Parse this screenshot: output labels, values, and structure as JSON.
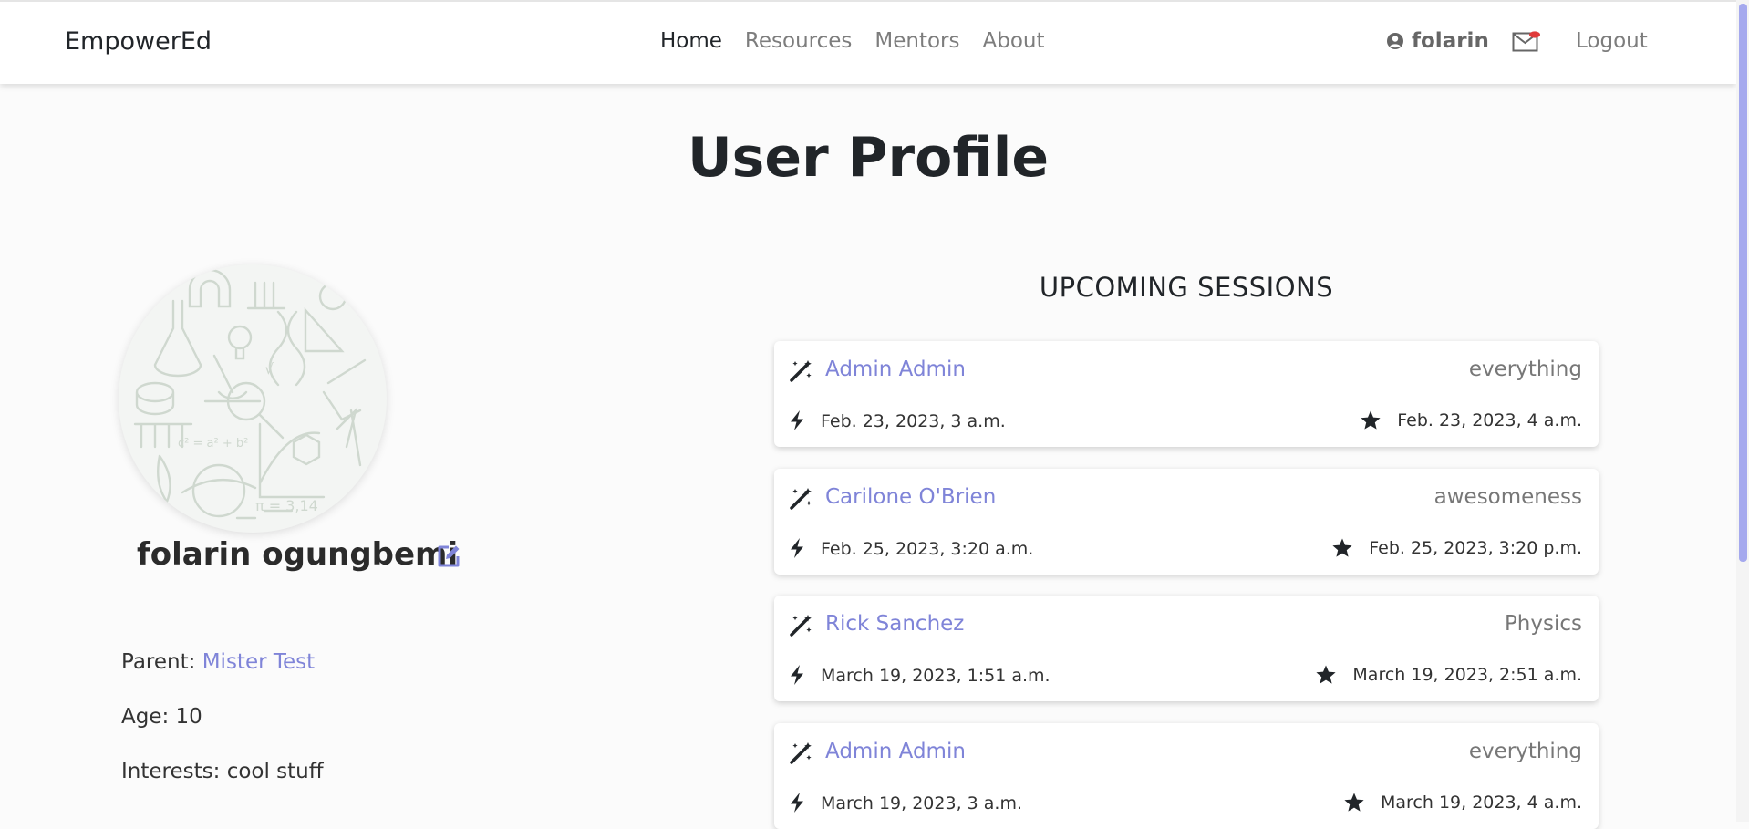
{
  "brand": "EmpowerEd",
  "nav": {
    "links": [
      "Home",
      "Resources",
      "Mentors",
      "About"
    ],
    "active": "Home",
    "username": "folarin",
    "logout": "Logout",
    "icons": {
      "user": "user-circle-icon",
      "mail": "envelope-icon"
    },
    "notification_color": "#e03a3a"
  },
  "page": {
    "title": "User Profile"
  },
  "profile": {
    "full_name": "folarin ogungbemi",
    "parent_label": "Parent:",
    "parent_name": "Mister Test",
    "age_label": "Age:",
    "age": "10",
    "interests_label": "Interests:",
    "interests": "cool stuff"
  },
  "sessions": {
    "title": "UPCOMING SESSIONS",
    "items": [
      {
        "mentor": "Admin Admin",
        "topic": "everything",
        "start": "Feb. 23, 2023, 3 a.m.",
        "end": "Feb. 23, 2023, 4 a.m."
      },
      {
        "mentor": "Carilone O'Brien",
        "topic": "awesomeness",
        "start": "Feb. 25, 2023, 3:20 a.m.",
        "end": "Feb. 25, 2023, 3:20 p.m."
      },
      {
        "mentor": "Rick Sanchez",
        "topic": "Physics",
        "start": "March 19, 2023, 1:51 a.m.",
        "end": "March 19, 2023, 2:51 a.m."
      },
      {
        "mentor": "Admin Admin",
        "topic": "everything",
        "start": "March 19, 2023, 3 a.m.",
        "end": "March 19, 2023, 4 a.m."
      }
    ]
  },
  "colors": {
    "accent": "#7f84d8",
    "scrollbar": "#a5a9ee"
  }
}
